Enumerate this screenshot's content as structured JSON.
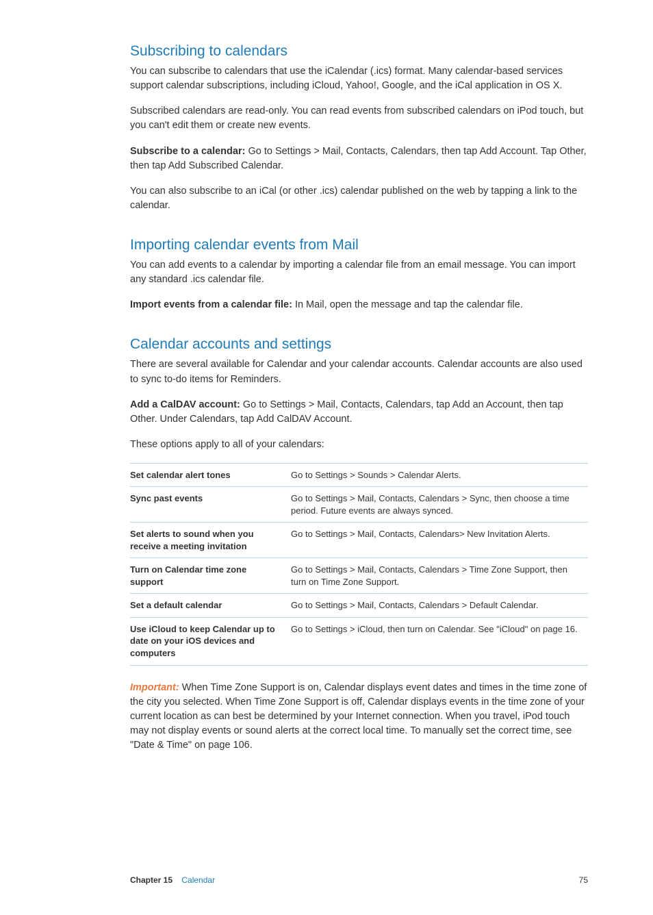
{
  "sections": [
    {
      "heading": "Subscribing to calendars",
      "paras": [
        {
          "text": "You can subscribe to calendars that use the iCalendar (.ics) format. Many calendar-based services support calendar subscriptions, including iCloud, Yahoo!, Google, and the iCal application in OS X."
        },
        {
          "text": "Subscribed calendars are read-only. You can read events from subscribed calendars on iPod touch, but you can't edit them or create new events."
        },
        {
          "lead": "Subscribe to a calendar:  ",
          "text": "Go to Settings > Mail, Contacts, Calendars, then tap Add Account. Tap Other, then tap Add Subscribed Calendar."
        },
        {
          "text": "You can also subscribe to an iCal (or other .ics) calendar published on the web by tapping a link to the calendar."
        }
      ]
    },
    {
      "heading": "Importing calendar events from Mail",
      "paras": [
        {
          "text": "You can add events to a calendar by importing a calendar file from an email message. You can import any standard .ics calendar file."
        },
        {
          "lead": "Import events from a calendar file:  ",
          "text": "In Mail, open the message and tap the calendar file."
        }
      ]
    },
    {
      "heading": "Calendar accounts and settings",
      "paras": [
        {
          "text": "There are several available for Calendar and your calendar accounts. Calendar accounts are also used to sync to-do items for Reminders."
        },
        {
          "lead": "Add a CalDAV account:  ",
          "text": "Go to Settings > Mail, Contacts, Calendars, tap Add an Account, then tap Other. Under Calendars, tap Add CalDAV Account."
        },
        {
          "text": "These options apply to all of your calendars:"
        }
      ],
      "table": [
        {
          "l": "Set calendar alert tones",
          "r": "Go to Settings > Sounds > Calendar Alerts."
        },
        {
          "l": "Sync past events",
          "r": "Go to Settings > Mail, Contacts, Calendars > Sync, then choose a time period. Future events are always synced."
        },
        {
          "l": "Set alerts to sound when you receive a meeting invitation",
          "r": "Go to Settings > Mail, Contacts, Calendars> New Invitation Alerts."
        },
        {
          "l": "Turn on Calendar time zone support",
          "r": "Go to Settings > Mail, Contacts, Calendars > Time Zone Support, then turn on Time Zone Support."
        },
        {
          "l": "Set a default calendar",
          "r": "Go to Settings > Mail, Contacts, Calendars > Default Calendar."
        },
        {
          "l": "Use iCloud to keep Calendar up to date on your iOS devices and computers",
          "r": "Go to Settings > iCloud, then turn on Calendar. See \"iCloud\" on page 16."
        }
      ],
      "callout": {
        "label": "Important:  ",
        "text": "When Time Zone Support is on, Calendar displays event dates and times in the time zone of the city you selected. When Time Zone Support is off, Calendar displays events in the time zone of your current location as can best be determined by your Internet connection. When you travel, iPod touch may not display events or sound alerts at the correct local time. To manually set the correct time, see \"Date & Time\" on page 106."
      }
    }
  ],
  "footer": {
    "chapter_label": "Chapter 15",
    "chapter_name": "Calendar",
    "page": "75"
  }
}
